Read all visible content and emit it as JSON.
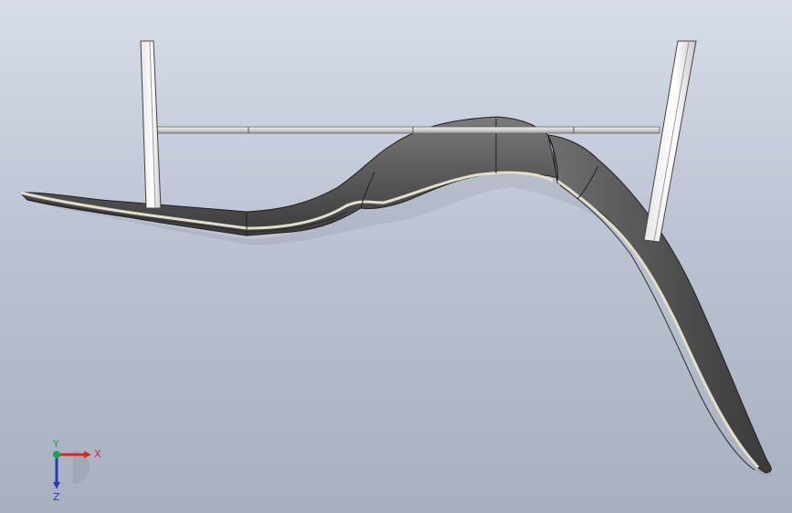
{
  "viewport": {
    "background_top": "#d8dde9",
    "background_bottom": "#a8b0c0"
  },
  "model": {
    "body_color": "#575757",
    "edge_color": "#d7d5c4",
    "post_color": "#ffffff",
    "rod_color": "#d8d8d8"
  },
  "triad": {
    "x_label": "X",
    "y_label": "Y",
    "z_label": "Z",
    "x_color": "#d12a2a",
    "y_color": "#16a54c",
    "z_color": "#2b39b5"
  }
}
